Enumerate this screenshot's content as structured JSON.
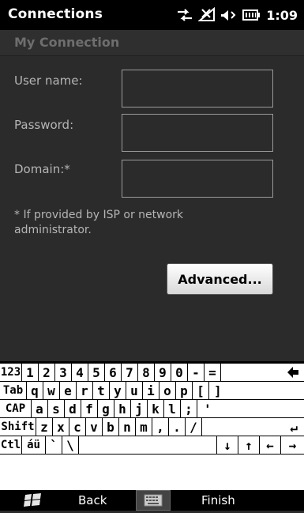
{
  "status_bar": {
    "title": "Connections",
    "time": "1:09"
  },
  "subheader": {
    "title": "My Connection"
  },
  "form": {
    "username_label": "User name:",
    "username_value": "",
    "password_label": "Password:",
    "password_value": "",
    "domain_label": "Domain:*",
    "domain_value": "",
    "note": "* If provided by ISP or network administrator.",
    "advanced_label": "Advanced..."
  },
  "keyboard": {
    "rows": [
      [
        "123",
        "1",
        "2",
        "3",
        "4",
        "5",
        "6",
        "7",
        "8",
        "9",
        "0",
        "-",
        "=",
        "◆"
      ],
      [
        "Tab",
        "q",
        "w",
        "e",
        "r",
        "t",
        "y",
        "u",
        "i",
        "o",
        "p",
        "[",
        "]"
      ],
      [
        "CAP",
        "a",
        "s",
        "d",
        "f",
        "g",
        "h",
        "j",
        "k",
        "l",
        ";",
        "'"
      ],
      [
        "Shift",
        "z",
        "x",
        "c",
        "v",
        "b",
        "n",
        "m",
        ",",
        ".",
        "/",
        "↵"
      ],
      [
        "Ctl",
        "áü",
        "`",
        "\\",
        "",
        "↓",
        "↑",
        "←",
        "→"
      ]
    ]
  },
  "bottom_bar": {
    "back_label": "Back",
    "finish_label": "Finish"
  }
}
